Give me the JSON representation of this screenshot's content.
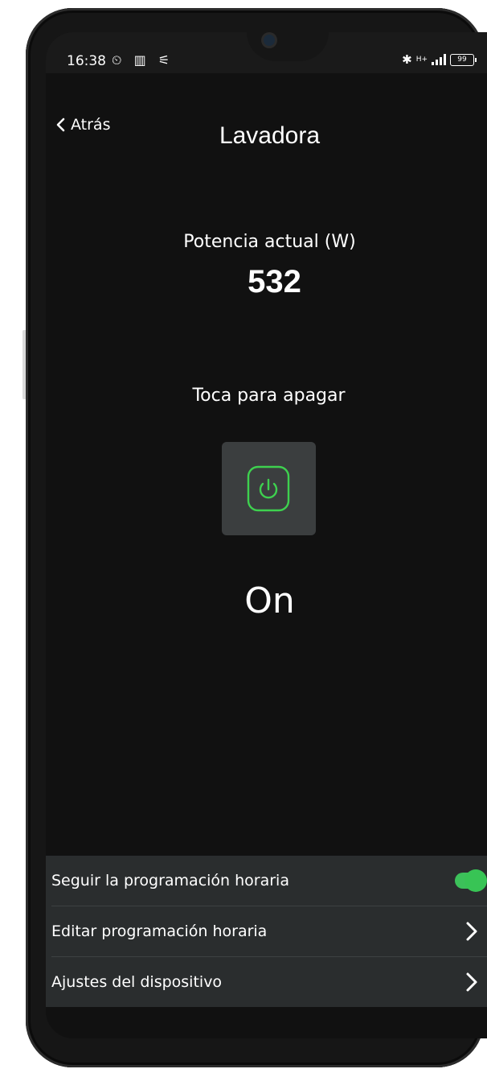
{
  "status_bar": {
    "time": "16:38",
    "left_icons": "⏲ ▥ ⚟",
    "signal": "H+",
    "battery": "99"
  },
  "header": {
    "back_label": "Atrás",
    "title": "Lavadora"
  },
  "power": {
    "label": "Potencia actual (W)",
    "value": "532"
  },
  "switch": {
    "hint": "Toca para apagar",
    "state": "On",
    "accent_color": "#3ed14f"
  },
  "settings": {
    "items": [
      {
        "label": "Seguir la programación horaria",
        "control": "toggle",
        "enabled": true
      },
      {
        "label": "Editar programación horaria",
        "control": "chevron-right-icon"
      },
      {
        "label": "Ajustes del dispositivo",
        "control": "chevron-right-icon"
      }
    ],
    "toggle_color": "#3cc15a"
  }
}
